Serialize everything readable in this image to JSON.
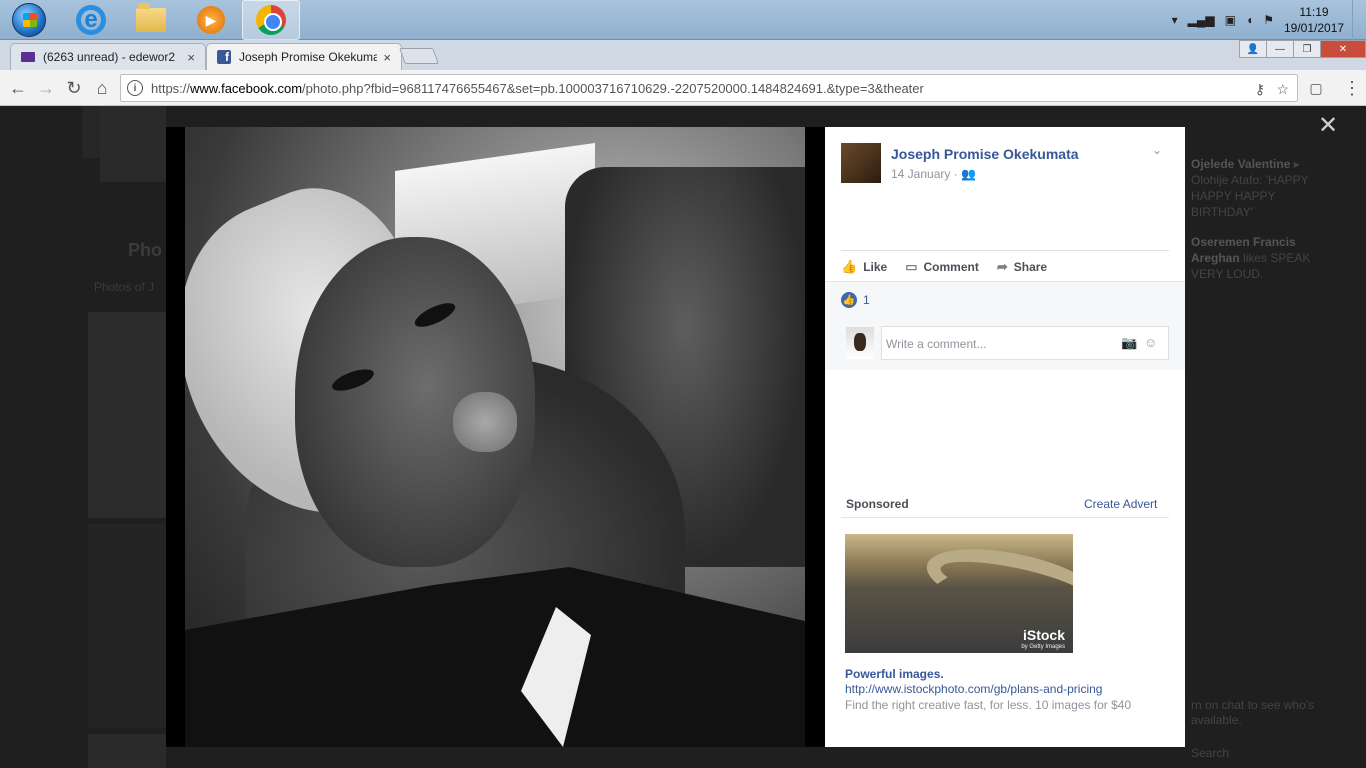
{
  "taskbar": {
    "clock_time": "11:19",
    "clock_date": "19/01/2017"
  },
  "tabs": [
    {
      "title": "(6263 unread) - edewor2",
      "close": "×"
    },
    {
      "title": "Joseph Promise Okekumata",
      "close": "×"
    }
  ],
  "address": {
    "url_prefix": "https://",
    "url_domain": "www.facebook.com",
    "url_path": "/photo.php?fbid=968117476655467&set=pb.100003716710629.-2207520000.1484824691.&type=3&theater"
  },
  "post": {
    "poster_name": "Joseph Promise Okekumata",
    "date": "14 January",
    "audience_icon": "friends-icon",
    "actions": {
      "like": "Like",
      "comment": "Comment",
      "share": "Share"
    },
    "like_count": "1",
    "comment_placeholder": "Write a comment..."
  },
  "sponsored": {
    "heading": "Sponsored",
    "create_advert": "Create Advert",
    "ad_brand": "iStock",
    "ad_brand_sub": "by Getty Images",
    "ad_title": "Powerful images.",
    "ad_url": "http://www.istockphoto.com/gb/plans-and-pricing",
    "ad_desc": "Find the right creative fast, for less. 10 images for $40"
  },
  "background": {
    "section_title": "Pho",
    "photos_of": "Photos of J",
    "ticker_1_name": "Ojelede Valentine",
    "ticker_1_rest": "Olohije Atafo: 'HAPPY HAPPY HAPPY BIRTHDAY'",
    "ticker_2_name": "Oseremen Francis Areghan",
    "ticker_2_rest": "likes SPEAK VERY LOUD.",
    "chat_hint": "rn on chat to see who's available.",
    "search_hint": "Search"
  },
  "colors": {
    "facebook_blue": "#365899",
    "like_blue": "#4267b2",
    "overlay_bg": "#1d1d1d"
  }
}
